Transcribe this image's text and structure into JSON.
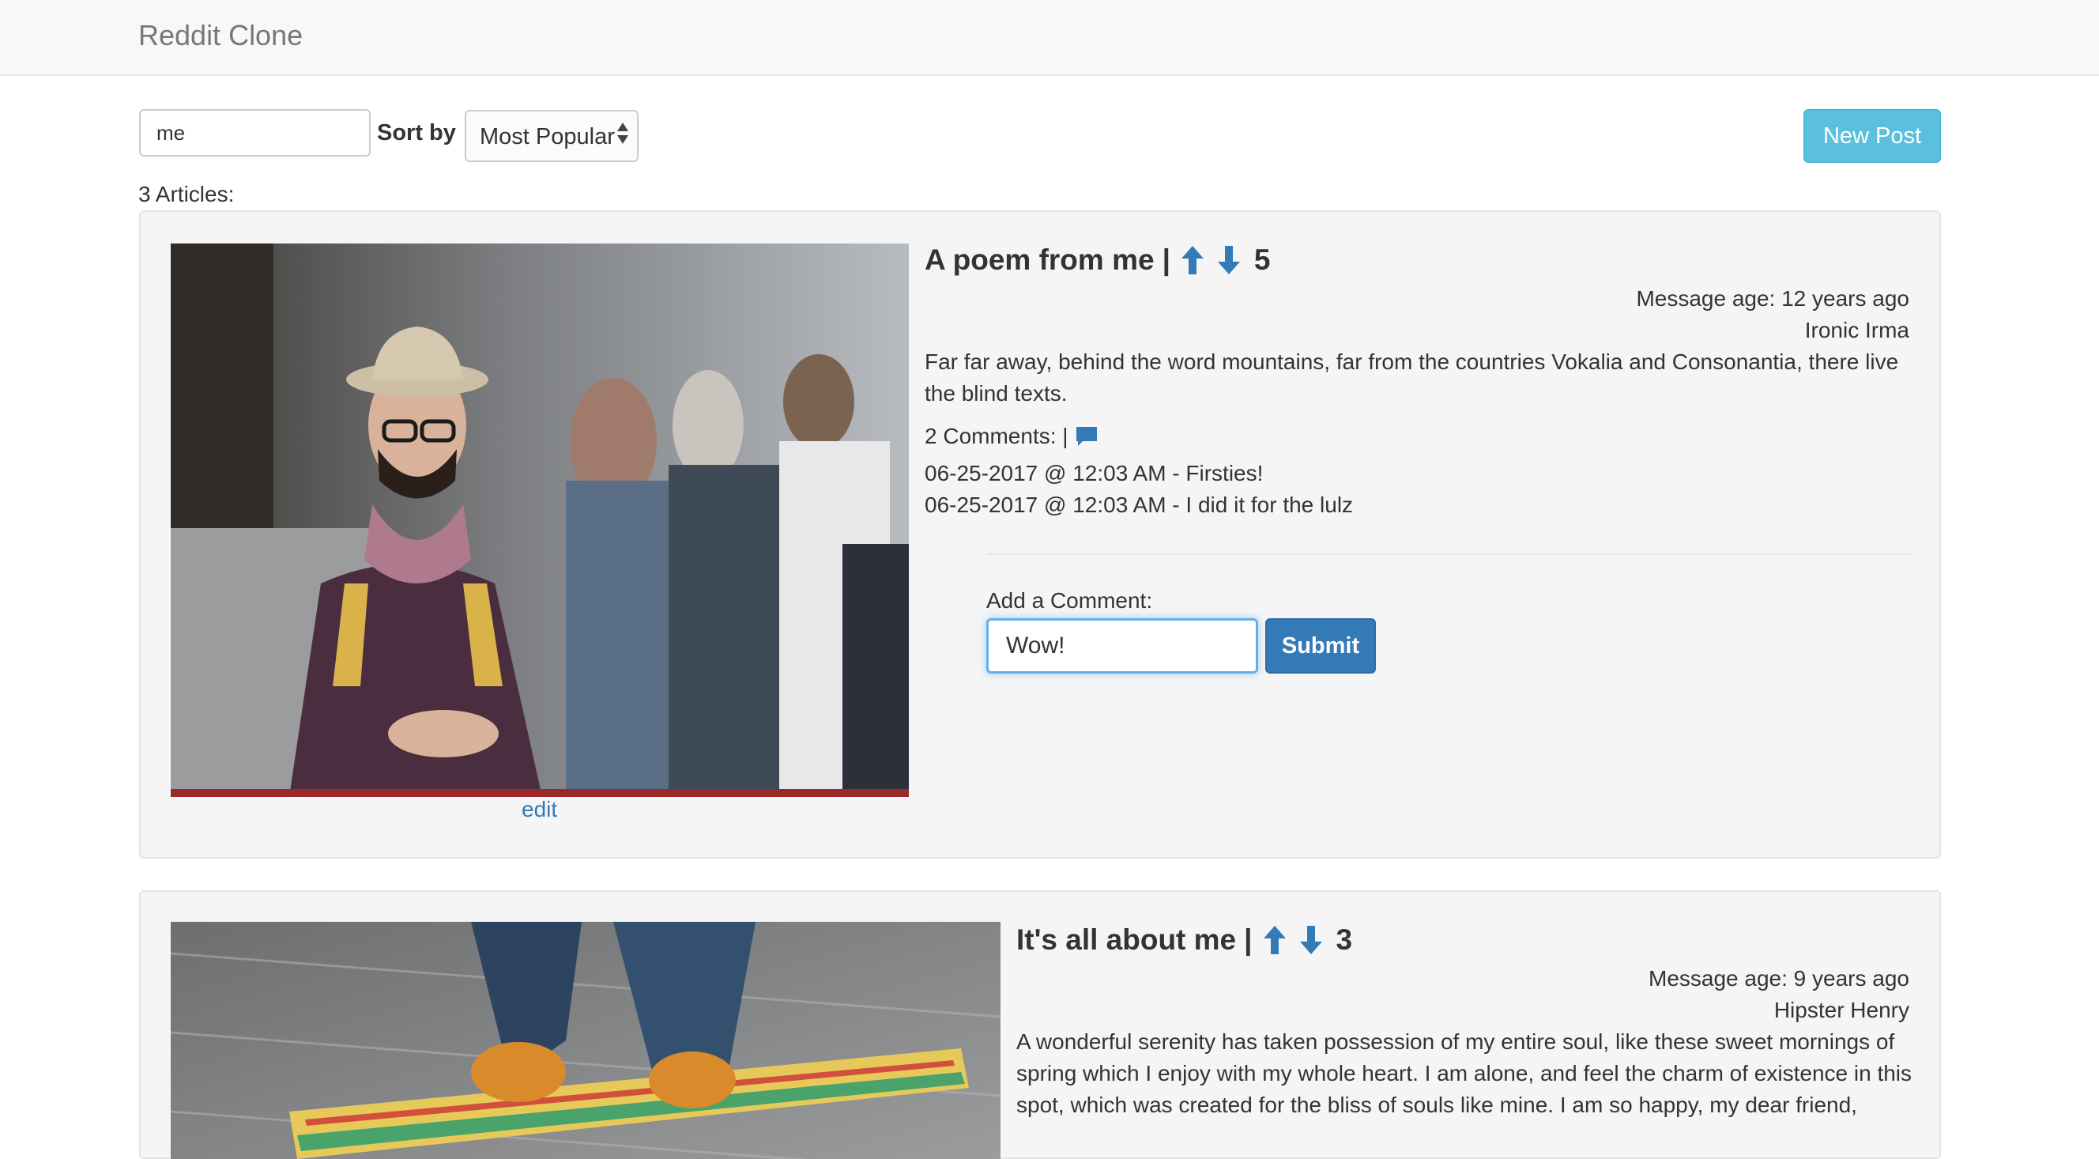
{
  "navbar": {
    "brand": "Reddit Clone"
  },
  "toolbar": {
    "search_value": "me",
    "sort_label": "Sort by",
    "sort_selected": "Most Popular",
    "new_post_label": "New Post"
  },
  "article_count": "3 Articles:",
  "articles": [
    {
      "title": "A poem from me",
      "separator": "|",
      "score": "5",
      "message_age": "Message age: 12 years ago",
      "author": "Ironic Irma",
      "body": "Far far away, behind the word mountains, far from the countries Vokalia and Consonantia, there live the blind texts.",
      "comments_label": "2 Comments: |",
      "comments": [
        "06-25-2017 @ 12:03 AM - Firsties!",
        "06-25-2017 @ 12:03 AM - I did it for the lulz"
      ],
      "add_comment_label": "Add a Comment:",
      "comment_input_value": "Wow!",
      "submit_label": "Submit",
      "edit_label": "edit"
    },
    {
      "title": "It's all about me",
      "separator": "|",
      "score": "3",
      "message_age": "Message age: 9 years ago",
      "author": "Hipster Henry",
      "body": "A wonderful serenity has taken possession of my entire soul, like these sweet mornings of spring which I enjoy with my whole heart. I am alone, and feel the charm of existence in this spot, which was created for the bliss of souls like mine. I am so happy, my dear friend,"
    }
  ],
  "colors": {
    "link_blue": "#337ab7",
    "info_button": "#5bc0de",
    "card_bg": "#f5f5f5",
    "navbar_bg": "#f8f8f8"
  },
  "icons": {
    "upvote": "arrow-up-icon",
    "downvote": "arrow-down-icon",
    "comment": "comment-bubble-icon",
    "sort": "sort-arrows-icon"
  }
}
